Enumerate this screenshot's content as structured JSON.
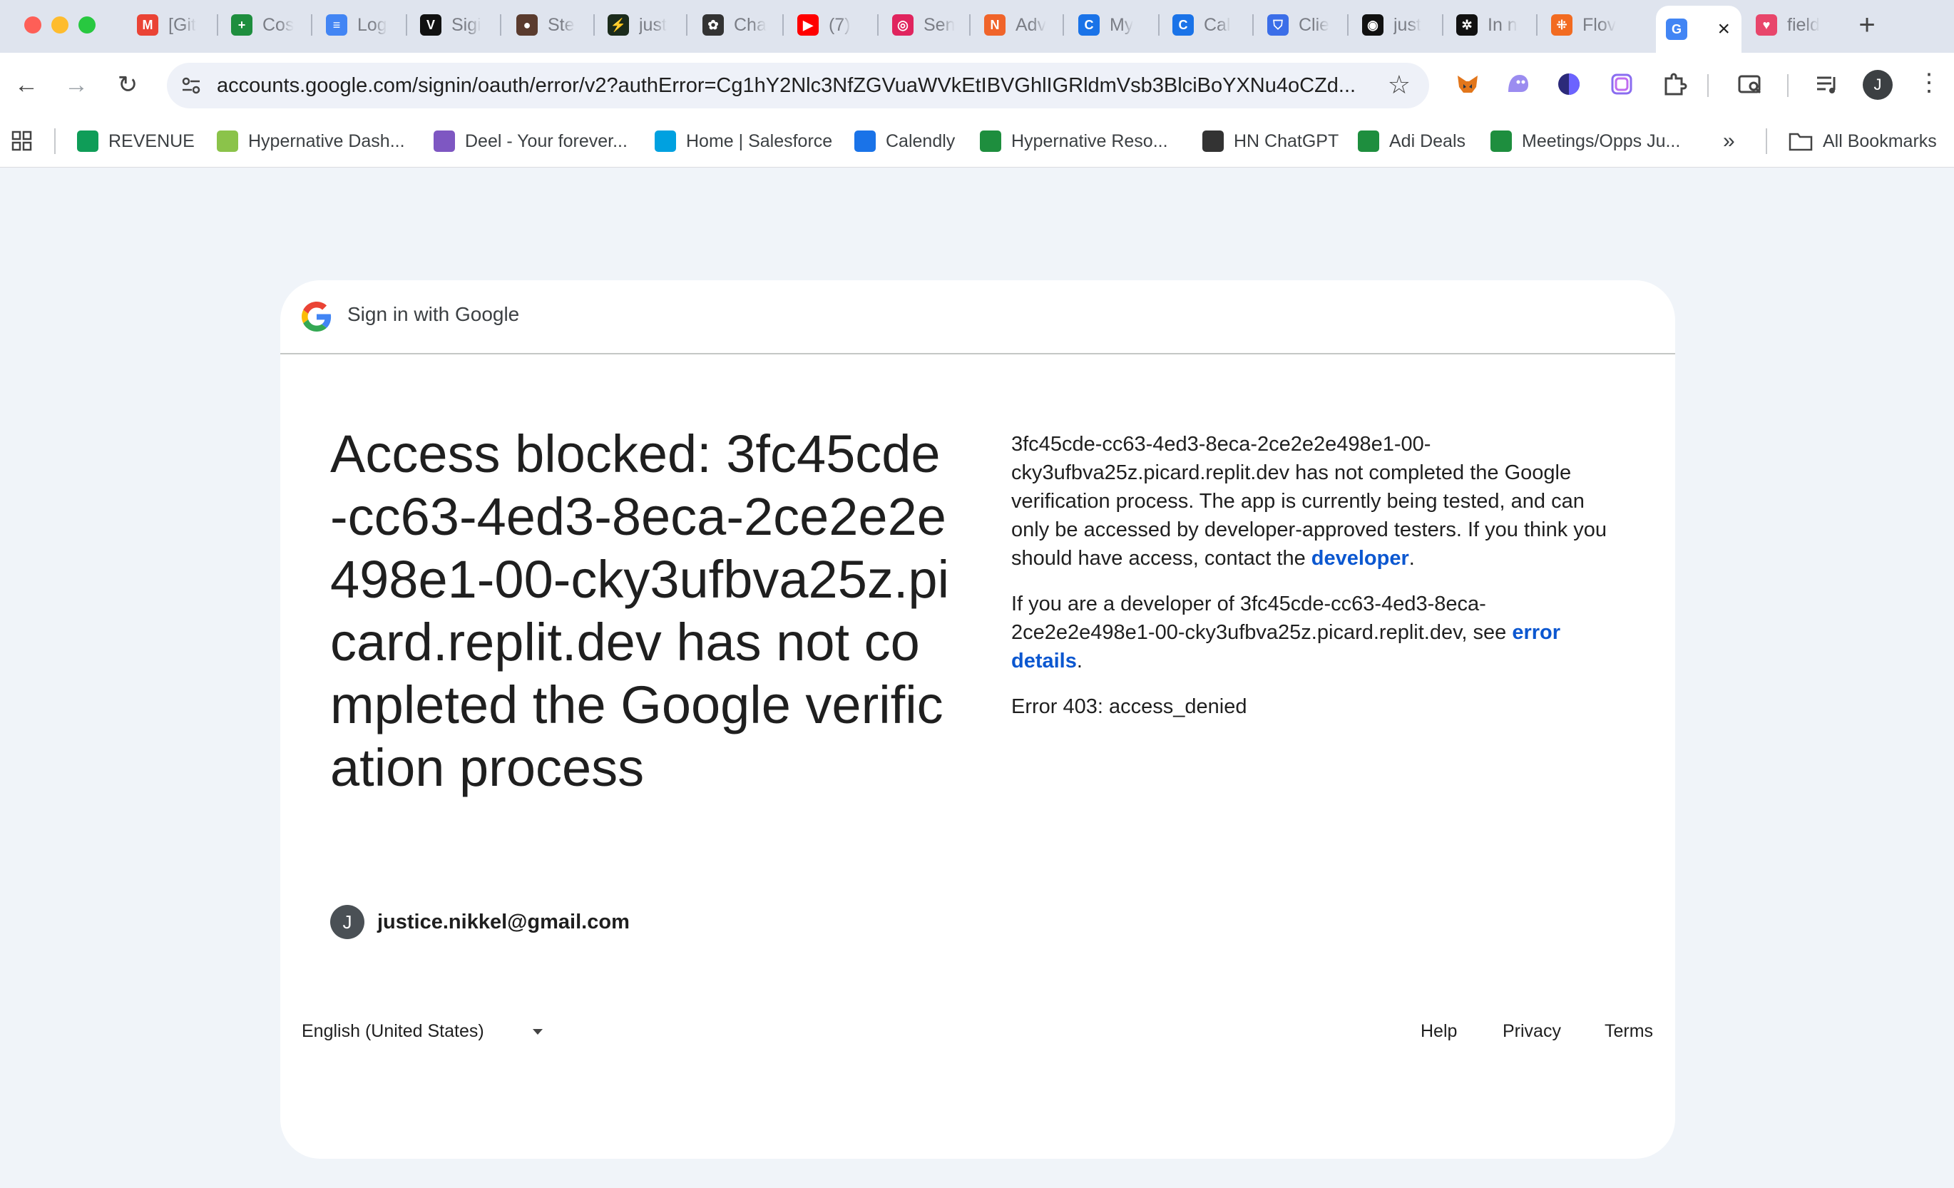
{
  "window": {
    "tabs": [
      {
        "label": "[Git",
        "icon": "gmail-icon",
        "color": "#ea4335",
        "glyph": "M"
      },
      {
        "label": "Cos",
        "icon": "sheets-icon",
        "color": "#1e8e3e",
        "glyph": "+"
      },
      {
        "label": "Log",
        "icon": "docs-icon",
        "color": "#4285f4",
        "glyph": "≡"
      },
      {
        "label": "Sigi",
        "icon": "v-logo-icon",
        "color": "#111111",
        "glyph": "V"
      },
      {
        "label": "Ste",
        "icon": "circle-logo-icon",
        "color": "#5a3b2e",
        "glyph": "●"
      },
      {
        "label": "just",
        "icon": "bolt-icon",
        "color": "#1b2b1b",
        "glyph": "⚡"
      },
      {
        "label": "Cha",
        "icon": "openai-icon",
        "color": "#333333",
        "glyph": "✿"
      },
      {
        "label": "(7)",
        "icon": "youtube-icon",
        "color": "#ff0000",
        "glyph": "▶"
      },
      {
        "label": "Sen",
        "icon": "target-icon",
        "color": "#e0245e",
        "glyph": "◎"
      },
      {
        "label": "Adv",
        "icon": "adv-icon",
        "color": "#f0642a",
        "glyph": "N"
      },
      {
        "label": "My",
        "icon": "calendly-icon",
        "color": "#1a73e8",
        "glyph": "C"
      },
      {
        "label": "Cal",
        "icon": "calendly-icon",
        "color": "#1a73e8",
        "glyph": "C"
      },
      {
        "label": "Clie",
        "icon": "shield-icon",
        "color": "#3b6ee8",
        "glyph": "⛉"
      },
      {
        "label": "just",
        "icon": "github-icon",
        "color": "#111111",
        "glyph": "◉"
      },
      {
        "label": "In n",
        "icon": "app-icon",
        "color": "#111111",
        "glyph": "✲"
      },
      {
        "label": "Flov",
        "icon": "flow-icon",
        "color": "#f26b21",
        "glyph": "⁜"
      },
      {
        "label": "",
        "icon": "google-icon",
        "color": "#4285f4",
        "glyph": "G"
      },
      {
        "label": "field",
        "icon": "heart-icon",
        "color": "#e8466b",
        "glyph": "♥"
      }
    ],
    "active_tab_close": "×",
    "new_tab": "+"
  },
  "toolbar": {
    "back": "←",
    "forward": "→",
    "reload": "↻",
    "url": "accounts.google.com/signin/oauth/error/v2?authError=Cg1hY2Nlc3NfZGVuaWVkEtIBVGhlIGRldmVsb3BlciBoYXNu4oCZd...",
    "star": "☆",
    "avatar": "J",
    "menu": "⋮"
  },
  "bookmarks": {
    "items": [
      {
        "label": "REVENUE",
        "icon": "drive-icon",
        "color": "#0f9d58"
      },
      {
        "label": "Hypernative Dash...",
        "icon": "hypernative-icon",
        "color": "#8bc34a"
      },
      {
        "label": "Deel - Your forever...",
        "icon": "deel-icon",
        "color": "#7e57c2"
      },
      {
        "label": "Home | Salesforce",
        "icon": "salesforce-icon",
        "color": "#00a1e0"
      },
      {
        "label": "Calendly",
        "icon": "calendly-icon",
        "color": "#1a73e8"
      },
      {
        "label": "Hypernative Reso...",
        "icon": "sheets-icon",
        "color": "#1e8e3e"
      },
      {
        "label": "HN ChatGPT",
        "icon": "openai-icon",
        "color": "#333333"
      },
      {
        "label": "Adi Deals",
        "icon": "sheets-icon",
        "color": "#1e8e3e"
      },
      {
        "label": "Meetings/Opps Ju...",
        "icon": "sheets-icon",
        "color": "#1e8e3e"
      }
    ],
    "overflow": "»",
    "all_bookmarks": "All Bookmarks"
  },
  "card": {
    "header": "Sign in with Google",
    "headline": "Access blocked: 3fc45cde-cc63-4ed3-8eca-2ce2e2e498e1-00-cky3ufbva25z.picard.replit.dev has not completed the Google verification process",
    "account_initial": "J",
    "account_email": "justice.nikkel@gmail.com",
    "p1_text": "3fc45cde-cc63-4ed3-8eca-2ce2e2e498e1-00-cky3ufbva25z.picard.replit.dev has not completed the Google verification process. The app is currently being tested, and can only be accessed by developer-approved testers. If you think you should have access, contact the ",
    "p1_link": "developer",
    "p1_end": ".",
    "p2_text": "If you are a developer of 3fc45cde-cc63-4ed3-8eca-2ce2e2e498e1-00-cky3ufbva25z.picard.replit.dev, see ",
    "p2_link": "error details",
    "p2_end": ".",
    "error": "Error 403: access_denied"
  },
  "footer": {
    "language": "English (United States)",
    "help": "Help",
    "privacy": "Privacy",
    "terms": "Terms"
  }
}
